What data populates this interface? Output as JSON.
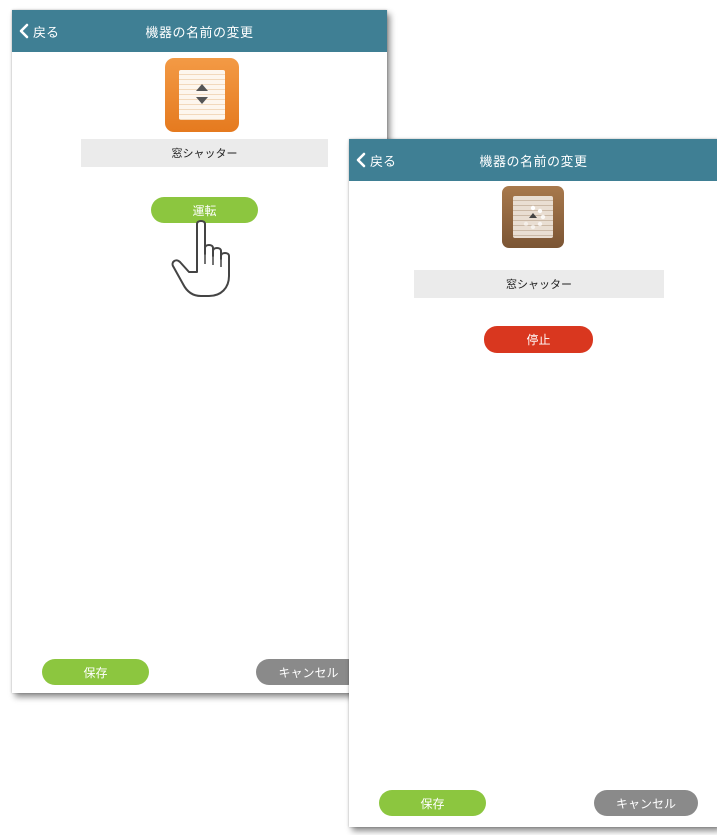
{
  "colors": {
    "navbar": "#3f7f94",
    "go_button": "#8cc63f",
    "stop_button": "#d9371f",
    "save_button": "#8cc63f",
    "cancel_button": "#8a8a8a",
    "name_field": "#ebebeb"
  },
  "screens": [
    {
      "navbar": {
        "back_label": "戻る",
        "title": "機器の名前の変更"
      },
      "device": {
        "icon": "shutter-icon",
        "name": "窓シャッター"
      },
      "action_button": "運転",
      "footer": {
        "save_label": "保存",
        "cancel_label": "キャンセル"
      },
      "pointer": "hand-pointer-icon"
    },
    {
      "navbar": {
        "back_label": "戻る",
        "title": "機器の名前の変更"
      },
      "device": {
        "icon": "shutter-loading-icon",
        "name": "窓シャッター"
      },
      "action_button": "停止",
      "footer": {
        "save_label": "保存",
        "cancel_label": "キャンセル"
      }
    }
  ]
}
